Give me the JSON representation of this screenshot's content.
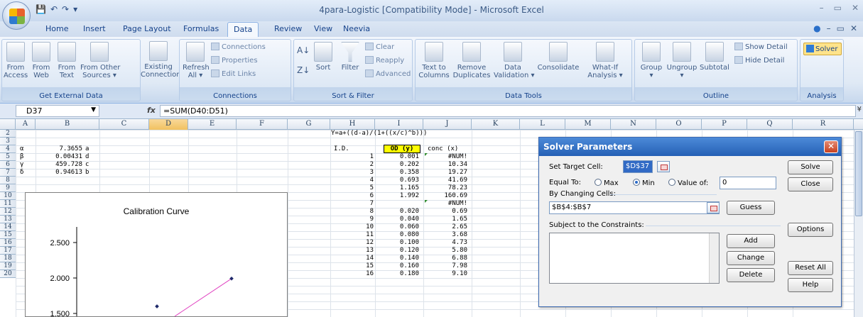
{
  "window": {
    "title": "4para-Logistic  [Compatibility Mode] - Microsoft Excel",
    "minimize": "–",
    "restore": "▭",
    "close": "✕"
  },
  "qat": {
    "save": "💾",
    "undo": "↶",
    "redo": "↷",
    "customize": "▾"
  },
  "tabs": [
    "Home",
    "Insert",
    "Page Layout",
    "Formulas",
    "Data",
    "Review",
    "View",
    "Neevia"
  ],
  "active_tab": "Data",
  "ribbon": {
    "get_external_data": {
      "label": "Get External Data",
      "buttons": [
        "From\nAccess",
        "From\nWeb",
        "From\nText",
        "From Other\nSources ▾"
      ]
    },
    "existing_connections": "Existing\nConnections",
    "connections": {
      "label": "Connections",
      "refresh": "Refresh\nAll ▾",
      "items": [
        "Connections",
        "Properties",
        "Edit Links"
      ]
    },
    "sort_filter": {
      "label": "Sort & Filter",
      "sort": "Sort",
      "filter": "Filter",
      "items": [
        "Clear",
        "Reapply",
        "Advanced"
      ]
    },
    "data_tools": {
      "label": "Data Tools",
      "buttons": [
        "Text to\nColumns",
        "Remove\nDuplicates",
        "Data\nValidation ▾",
        "Consolidate",
        "What-If\nAnalysis ▾"
      ]
    },
    "outline": {
      "label": "Outline",
      "buttons": [
        "Group\n▾",
        "Ungroup\n▾",
        "Subtotal"
      ],
      "items": [
        "Show Detail",
        "Hide Detail"
      ]
    },
    "analysis": {
      "label": "Analysis",
      "solver": "Solver"
    }
  },
  "formula_bar": {
    "name_box": "D37",
    "fx": "fx",
    "formula": "=SUM(D40:D51)"
  },
  "columns": [
    "A",
    "B",
    "C",
    "D",
    "E",
    "F",
    "G",
    "H",
    "I",
    "J",
    "K",
    "L",
    "M",
    "N",
    "O",
    "P",
    "Q",
    "R"
  ],
  "selected_column": "D",
  "rows": [
    "2",
    "3",
    "4",
    "5",
    "6",
    "7",
    "8",
    "9",
    "10",
    "11",
    "12",
    "13",
    "14",
    "15",
    "16",
    "17",
    "18",
    "19",
    "20"
  ],
  "cells": {
    "formula_note": "Y=a+((d-a)/(1+((x/c)^b)))",
    "params": [
      {
        "sym": "α",
        "val": "7.3655",
        "name": "a"
      },
      {
        "sym": "β",
        "val": "0.00431",
        "name": "d"
      },
      {
        "sym": "γ",
        "val": "459.728",
        "name": "c"
      },
      {
        "sym": "δ",
        "val": "0.94613",
        "name": "b"
      }
    ],
    "hdr_id": "I.D.",
    "hdr_od": "OD (y)",
    "hdr_conc": "conc (x)",
    "table": [
      [
        "1",
        "0.001",
        "#NUM!"
      ],
      [
        "2",
        "0.202",
        "10.34"
      ],
      [
        "3",
        "0.358",
        "19.27"
      ],
      [
        "4",
        "0.693",
        "41.69"
      ],
      [
        "5",
        "1.165",
        "78.23"
      ],
      [
        "6",
        "1.992",
        "160.69"
      ],
      [
        "7",
        "",
        "#NUM!"
      ],
      [
        "8",
        "0.020",
        "0.69"
      ],
      [
        "9",
        "0.040",
        "1.65"
      ],
      [
        "10",
        "0.060",
        "2.65"
      ],
      [
        "11",
        "0.080",
        "3.68"
      ],
      [
        "12",
        "0.100",
        "4.73"
      ],
      [
        "13",
        "0.120",
        "5.80"
      ],
      [
        "14",
        "0.140",
        "6.88"
      ],
      [
        "15",
        "0.160",
        "7.98"
      ],
      [
        "16",
        "0.180",
        "9.10"
      ]
    ]
  },
  "chart_data": {
    "type": "scatter",
    "title": "Calibration Curve",
    "xlabel": "",
    "ylabel": "",
    "y_ticks": [
      "2.500",
      "2.000",
      "1.500"
    ],
    "ylim": [
      1.5,
      2.5
    ],
    "markers": [
      {
        "y": 1.992
      },
      {
        "y": 1.6
      }
    ],
    "line_color": "#e040c0",
    "marker_color": "#1f2a6b"
  },
  "solver": {
    "title": "Solver Parameters",
    "set_target_label": "Set Target Cell:",
    "set_target_value": "$D$37",
    "equal_to_label": "Equal To:",
    "opt_max": "Max",
    "opt_min": "Min",
    "opt_value": "Value of:",
    "value_of": "0",
    "by_changing_label": "By Changing Cells:",
    "by_changing_value": "$B$4:$B$7",
    "guess": "Guess",
    "constraints_label": "Subject to the Constraints:",
    "add": "Add",
    "change": "Change",
    "delete": "Delete",
    "solve": "Solve",
    "close": "Close",
    "options": "Options",
    "reset_all": "Reset All",
    "help": "Help"
  }
}
